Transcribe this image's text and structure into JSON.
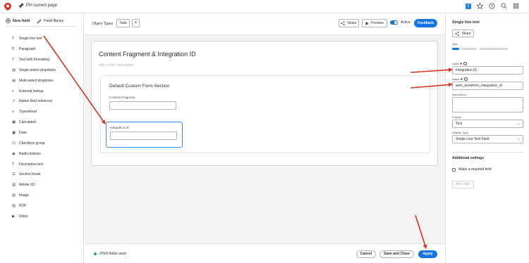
{
  "topbar": {
    "pin_label": "Pin current page",
    "badge_count": "1"
  },
  "left_panel": {
    "tabs": [
      {
        "label": "New field",
        "active": true
      },
      {
        "label": "Field library",
        "active": false
      }
    ],
    "fields": [
      {
        "icon": "T",
        "label": "Single line text"
      },
      {
        "icon": "¶",
        "label": "Paragraph"
      },
      {
        "icon": "T",
        "label": "Text with formatting"
      },
      {
        "icon": "▤",
        "label": "Single-select dropdown"
      },
      {
        "icon": "▤",
        "label": "Multi-select dropdown"
      },
      {
        "icon": "◐",
        "label": "External lookup"
      },
      {
        "icon": "↗",
        "label": "Native field reference"
      },
      {
        "icon": "≡",
        "label": "Typeahead"
      },
      {
        "icon": "▦",
        "label": "Calculated"
      },
      {
        "icon": "▣",
        "label": "Date"
      },
      {
        "icon": "☑",
        "label": "Checkbox group"
      },
      {
        "icon": "◉",
        "label": "Radio buttons"
      },
      {
        "icon": "T",
        "label": "Descriptive text"
      },
      {
        "icon": "☰",
        "label": "Section break"
      },
      {
        "icon": "▥",
        "label": "Adobe XD"
      },
      {
        "icon": "▨",
        "label": "Image"
      },
      {
        "icon": "▧",
        "label": "PDF"
      },
      {
        "icon": "▶",
        "label": "Video"
      }
    ]
  },
  "toolbar": {
    "object_types_label": "Object Types",
    "task_label": "Task",
    "plus_label": "+",
    "share_label": "Share",
    "preview_label": "Preview",
    "active_label": "Active",
    "feedback_label": "Feedback"
  },
  "form": {
    "title": "Content Fragment & Integration ID",
    "description_placeholder": "Add a form description",
    "section_title": "Default Custom Form Section",
    "field1_label": "Content Fragment",
    "field2_label": "Integration ID"
  },
  "footer": {
    "fields_used": "2/500 fields used",
    "cancel_label": "Cancel",
    "save_close_label": "Save and Close",
    "apply_label": "Apply"
  },
  "right_panel": {
    "title": "Single line text",
    "share_label": "Share",
    "size_label": "Size",
    "label_label": "Label ✱",
    "label_value": "Integration ID",
    "name_label": "Name ✱",
    "name_value": "aem_workfront_integration_id",
    "instructions_label": "Instructions",
    "format_label": "Format",
    "format_value": "Text",
    "display_type_label": "Display Type",
    "display_type_value": "Single Line Text Field",
    "additional_settings": "Additional settings",
    "required_label": "Make a required field",
    "add_logic_label": "Add logic"
  },
  "colors": {
    "accent": "#1473e6",
    "arrow": "#e0301e"
  }
}
